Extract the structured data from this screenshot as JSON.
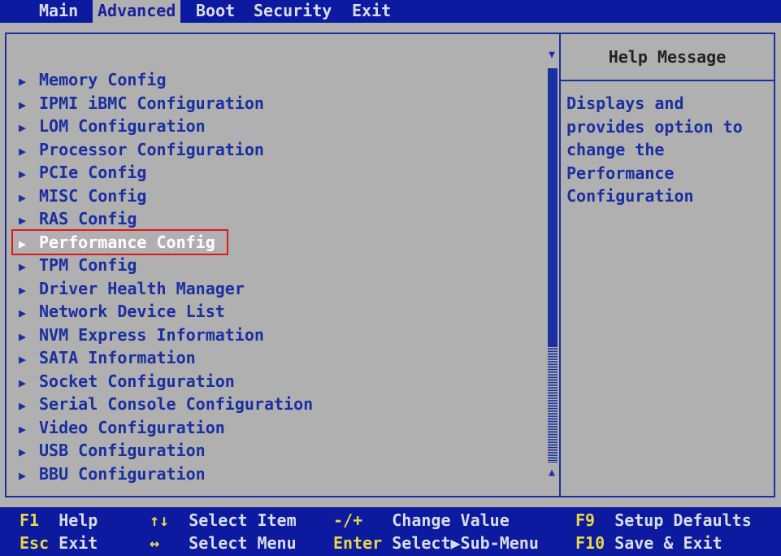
{
  "tabs": [
    {
      "label": "Main",
      "active": false
    },
    {
      "label": "Advanced",
      "active": true
    },
    {
      "label": "Boot",
      "active": false
    },
    {
      "label": "Security",
      "active": false
    },
    {
      "label": "Exit",
      "active": false
    }
  ],
  "menu": {
    "items": [
      {
        "label": "Memory Config"
      },
      {
        "label": "IPMI iBMC Configuration"
      },
      {
        "label": "LOM Configuration"
      },
      {
        "label": "Processor Configuration"
      },
      {
        "label": "PCIe Config"
      },
      {
        "label": "MISC Config"
      },
      {
        "label": "RAS Config"
      },
      {
        "label": "Performance Config",
        "selected": true
      },
      {
        "label": "TPM Config"
      },
      {
        "label": "Driver Health Manager"
      },
      {
        "label": "Network Device List"
      },
      {
        "label": "NVM Express Information"
      },
      {
        "label": "SATA Information"
      },
      {
        "label": "Socket Configuration"
      },
      {
        "label": "Serial Console Configuration"
      },
      {
        "label": "Video Configuration"
      },
      {
        "label": "USB Configuration"
      },
      {
        "label": "BBU Configuration"
      }
    ]
  },
  "help": {
    "title": "Help Message",
    "lines": [
      "Displays and",
      "provides option to",
      "change the",
      "Performance",
      "Configuration"
    ]
  },
  "scroll": {
    "up_glyph": "▼",
    "down_glyph": "▲"
  },
  "footer": {
    "keys": [
      {
        "key": "F1",
        "desc": "Help"
      },
      {
        "key": "Esc",
        "desc": "Exit"
      },
      {
        "key": "↑↓",
        "desc": "Select Item"
      },
      {
        "key": "↔",
        "desc": "Select Menu"
      },
      {
        "key": "-/+",
        "desc": "Change Value"
      },
      {
        "key": "Enter",
        "desc": "Select▶Sub-Menu"
      },
      {
        "key": "F9",
        "desc": "Setup Defaults"
      },
      {
        "key": "F10",
        "desc": "Save & Exit"
      }
    ]
  },
  "colors": {
    "bar_blue": "#0b1a9e",
    "panel_gray": "#b0b0b0",
    "text_blue": "#1a2fa0",
    "key_yellow": "#e8d84a",
    "highlight_red": "#e01818"
  }
}
